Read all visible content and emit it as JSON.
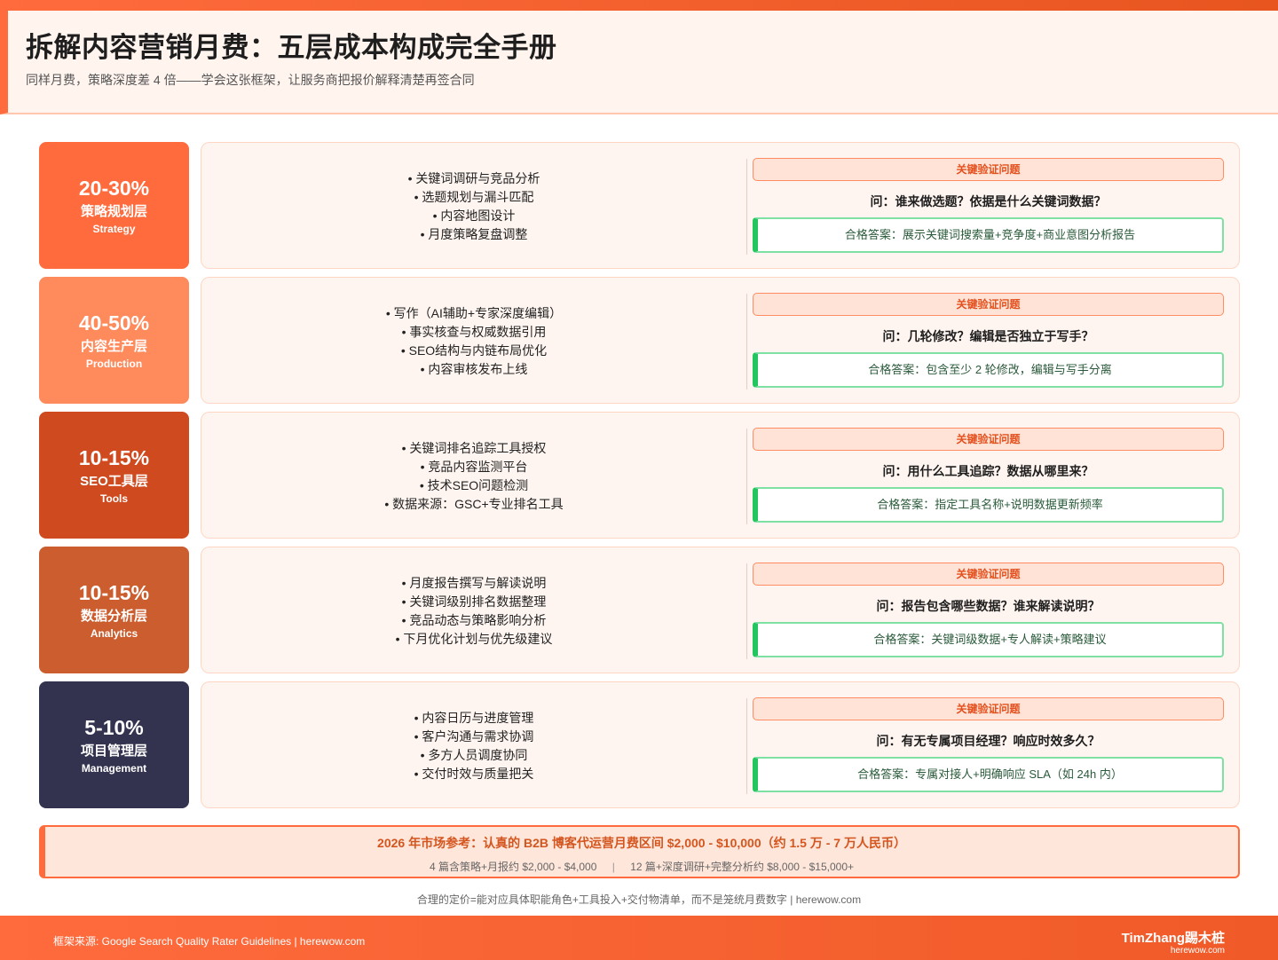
{
  "header": {
    "title": "拆解内容营销月费：五层成本构成完全手册",
    "subtitle": "同样月费，策略深度差 4 倍——学会这张框架，让服务商把报价解释清楚再签合同"
  },
  "colors": {
    "strategy": "#ff6b3d",
    "production": "#ff8a5c",
    "tools": "#cf4a1e",
    "analytics": "#cc5d2e",
    "management": "#333350"
  },
  "layers": [
    {
      "pct": "20-30%",
      "zh": "策略规划层",
      "en": "Strategy",
      "bullets": [
        "• 关键词调研与竞品分析",
        "• 选题规划与漏斗匹配",
        "• 内容地图设计",
        "• 月度策略复盘调整"
      ],
      "tag": "关键验证问题",
      "question": "问：谁来做选题？依据是什么关键词数据？",
      "answer": "合格答案：展示关键词搜索量+竞争度+商业意图分析报告"
    },
    {
      "pct": "40-50%",
      "zh": "内容生产层",
      "en": "Production",
      "bullets": [
        "• 写作（AI辅助+专家深度编辑）",
        "• 事实核查与权威数据引用",
        "• SEO结构与内链布局优化",
        "• 内容审核发布上线"
      ],
      "tag": "关键验证问题",
      "question": "问：几轮修改？编辑是否独立于写手？",
      "answer": "合格答案：包含至少 2 轮修改，编辑与写手分离"
    },
    {
      "pct": "10-15%",
      "zh": "SEO工具层",
      "en": "Tools",
      "bullets": [
        "• 关键词排名追踪工具授权",
        "• 竞品内容监测平台",
        "• 技术SEO问题检测",
        "• 数据来源：GSC+专业排名工具"
      ],
      "tag": "关键验证问题",
      "question": "问：用什么工具追踪？数据从哪里来？",
      "answer": "合格答案：指定工具名称+说明数据更新频率"
    },
    {
      "pct": "10-15%",
      "zh": "数据分析层",
      "en": "Analytics",
      "bullets": [
        "• 月度报告撰写与解读说明",
        "• 关键词级别排名数据整理",
        "• 竞品动态与策略影响分析",
        "• 下月优化计划与优先级建议"
      ],
      "tag": "关键验证问题",
      "question": "问：报告包含哪些数据？谁来解读说明？",
      "answer": "合格答案：关键词级数据+专人解读+策略建议"
    },
    {
      "pct": "5-10%",
      "zh": "项目管理层",
      "en": "Management",
      "bullets": [
        "• 内容日历与进度管理",
        "• 客户沟通与需求协调",
        "• 多方人员调度协同",
        "• 交付时效与质量把关"
      ],
      "tag": "关键验证问题",
      "question": "问：有无专属项目经理？响应时效多久？",
      "answer": "合格答案：专属对接人+明确响应 SLA（如 24h 内）"
    }
  ],
  "market": {
    "title": "2026 年市场参考：认真的 B2B 博客代运营月费区间 $2,000 - $10,000（约 1.5 万 - 7 万人民币）",
    "left": "4 篇含策略+月报约 $2,000 - $4,000",
    "sep": "|",
    "right": "12 篇+深度调研+完整分析约 $8,000 - $15,000+"
  },
  "note": "合理的定价=能对应具体职能角色+工具投入+交付物清单，而不是笼统月费数字 | herewow.com",
  "footer": {
    "source": "框架来源: Google Search Quality Rater Guidelines | herewow.com",
    "brand": "TimZhang踢木桩",
    "brand_sub": "herewow.com"
  }
}
